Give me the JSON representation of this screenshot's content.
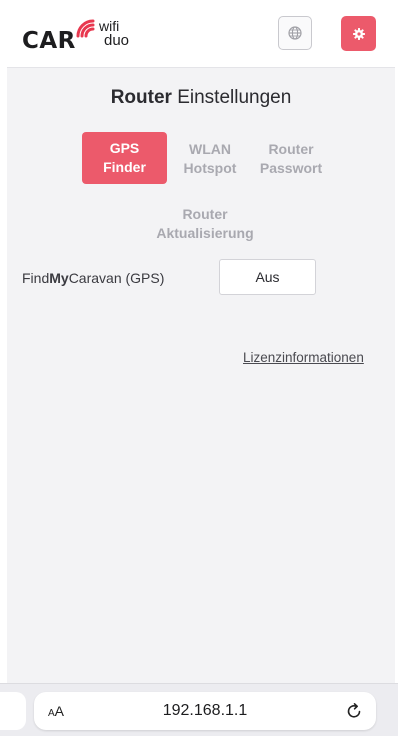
{
  "header": {
    "logo_car": "CAR",
    "logo_wifi": "wifi",
    "logo_duo": "duo",
    "language_icon": "globe-icon",
    "settings_icon": "gear-icon"
  },
  "title": {
    "bold": "Router",
    "rest": "Einstellungen"
  },
  "tabs": [
    {
      "label": "GPS\nFinder",
      "active": true
    },
    {
      "label": "WLAN\nHotspot",
      "active": false
    },
    {
      "label": "Router\nPasswort",
      "active": false
    },
    {
      "label": "Router\nAktualisierung",
      "active": false
    }
  ],
  "gps": {
    "label_prefix": "Find",
    "label_strong": "My",
    "label_suffix": "Caravan (GPS)",
    "toggle_value": "Aus"
  },
  "license_link": "Lizenzinformationen",
  "browser": {
    "text_size_label_small": "A",
    "text_size_label_large": "A",
    "url": "192.168.1.1",
    "reload_icon": "reload-icon"
  },
  "colors": {
    "accent": "#ec5a6b",
    "background": "#f3f3f5",
    "inactive_tab": "#a9a9b0"
  }
}
